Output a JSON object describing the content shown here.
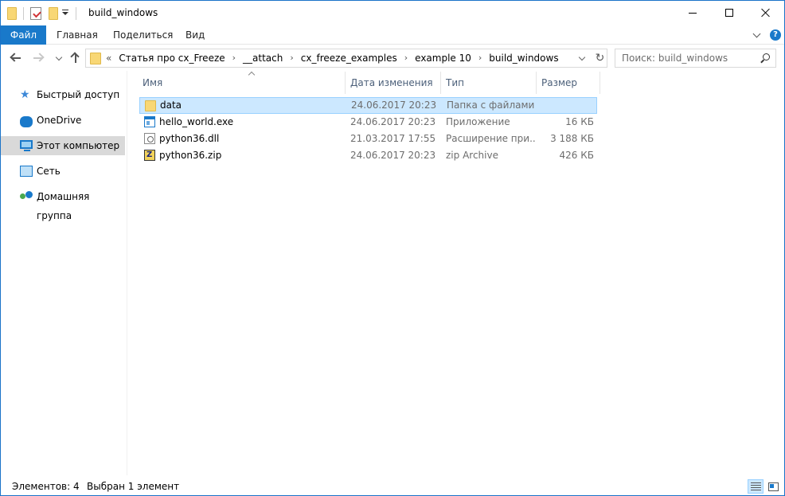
{
  "window": {
    "title": "build_windows"
  },
  "ribbon": {
    "tabs": [
      {
        "label": "Файл"
      },
      {
        "label": "Главная"
      },
      {
        "label": "Поделиться"
      },
      {
        "label": "Вид"
      }
    ],
    "help": "?"
  },
  "address": {
    "overflow": "«",
    "crumbs": [
      "Статья про cx_Freeze",
      "__attach",
      "cx_freeze_examples",
      "example 10",
      "build_windows"
    ],
    "separator": "›"
  },
  "search": {
    "placeholder": "Поиск: build_windows"
  },
  "nav_pane": {
    "items": [
      {
        "label": "Быстрый доступ",
        "icon": "quick-access-star-icon"
      },
      {
        "label": "OneDrive",
        "icon": "onedrive-cloud-icon"
      },
      {
        "label": "Этот компьютер",
        "icon": "this-pc-icon",
        "selected": true
      },
      {
        "label": "Сеть",
        "icon": "network-icon"
      },
      {
        "label": "Домашняя группа",
        "icon": "homegroup-icon"
      }
    ]
  },
  "columns": {
    "name": "Имя",
    "date": "Дата изменения",
    "type": "Тип",
    "size": "Размер"
  },
  "files": [
    {
      "name": "data",
      "date": "24.06.2017 20:23",
      "type": "Папка с файлами",
      "size": "",
      "icon": "folder-icon",
      "selected": true
    },
    {
      "name": "hello_world.exe",
      "date": "24.06.2017 20:23",
      "type": "Приложение",
      "size": "16 КБ",
      "icon": "exe-icon"
    },
    {
      "name": "python36.dll",
      "date": "21.03.2017 17:55",
      "type": "Расширение при...",
      "size": "3 188 КБ",
      "icon": "dll-icon"
    },
    {
      "name": "python36.zip",
      "date": "24.06.2017 20:23",
      "type": "zip Archive",
      "size": "426 КБ",
      "icon": "zip-icon"
    }
  ],
  "status": {
    "items_count": "Элементов: 4",
    "selected": "Выбран 1 элемент"
  },
  "colors": {
    "accent": "#1979ca",
    "selection_bg": "#cce8ff",
    "selection_border": "#99d1ff"
  }
}
